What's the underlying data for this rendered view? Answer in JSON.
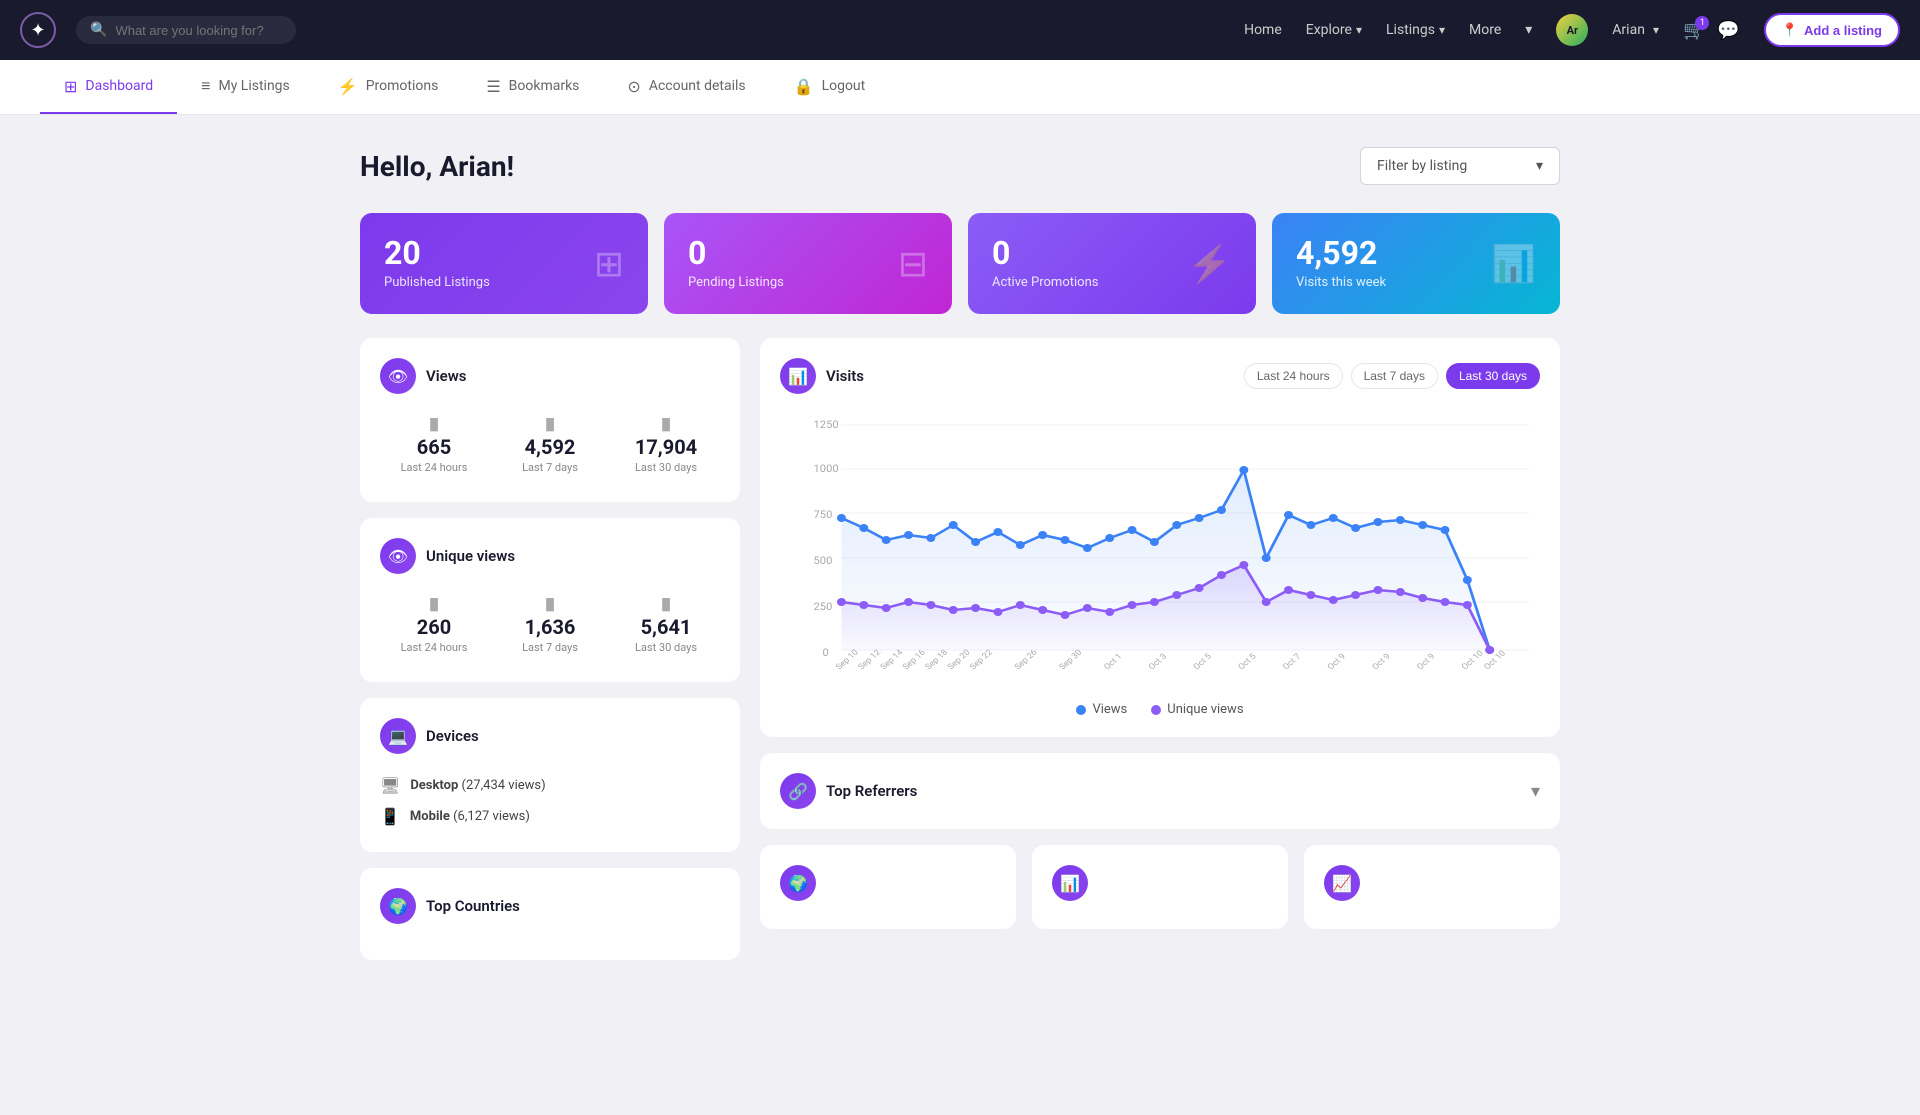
{
  "app": {
    "logo_char": "✦"
  },
  "top_nav": {
    "search_placeholder": "What are you looking for?",
    "links": [
      {
        "label": "Home",
        "has_dropdown": false
      },
      {
        "label": "Explore",
        "has_dropdown": true
      },
      {
        "label": "Listings",
        "has_dropdown": true
      },
      {
        "label": "More",
        "has_dropdown": true
      }
    ],
    "user": {
      "name": "Arian",
      "avatar_initials": "Ar"
    },
    "cart_count": "1",
    "add_listing_label": "Add a listing"
  },
  "sub_nav": {
    "items": [
      {
        "label": "Dashboard",
        "icon": "⊞",
        "active": true
      },
      {
        "label": "My Listings",
        "icon": "≡",
        "active": false
      },
      {
        "label": "Promotions",
        "icon": "⚡",
        "active": false
      },
      {
        "label": "Bookmarks",
        "icon": "☰",
        "active": false
      },
      {
        "label": "Account details",
        "icon": "⊙",
        "active": false
      },
      {
        "label": "Logout",
        "icon": "🔒",
        "active": false
      }
    ]
  },
  "page": {
    "title": "Hello, Arian!",
    "filter_label": "Filter by listing",
    "filter_placeholder": "Filter by listing"
  },
  "stat_cards": [
    {
      "number": "20",
      "label": "Published Listings",
      "icon": "⊞"
    },
    {
      "number": "0",
      "label": "Pending Listings",
      "icon": "⊟"
    },
    {
      "number": "0",
      "label": "Active Promotions",
      "icon": "⚡"
    },
    {
      "number": "4,592",
      "label": "Visits this week",
      "icon": "📊"
    }
  ],
  "views_widget": {
    "title": "Views",
    "stats": [
      {
        "value": "665",
        "label": "Last 24 hours"
      },
      {
        "value": "4,592",
        "label": "Last 7 days"
      },
      {
        "value": "17,904",
        "label": "Last 30 days"
      }
    ]
  },
  "unique_views_widget": {
    "title": "Unique views",
    "stats": [
      {
        "value": "260",
        "label": "Last 24 hours"
      },
      {
        "value": "1,636",
        "label": "Last 7 days"
      },
      {
        "value": "5,641",
        "label": "Last 30 days"
      }
    ]
  },
  "devices_widget": {
    "title": "Devices",
    "devices": [
      {
        "name": "Desktop",
        "views": "27,434 views"
      },
      {
        "name": "Mobile",
        "views": "6,127 views"
      }
    ]
  },
  "top_countries_widget": {
    "title": "Top Countries"
  },
  "visits_widget": {
    "title": "Visits",
    "time_filters": [
      {
        "label": "Last 24 hours",
        "active": false
      },
      {
        "label": "Last 7 days",
        "active": false
      },
      {
        "label": "Last 30 days",
        "active": true
      }
    ],
    "y_labels": [
      "1250",
      "1000",
      "750",
      "500",
      "250",
      "0"
    ],
    "legend": [
      {
        "label": "Views",
        "color": "#3b82f6"
      },
      {
        "label": "Unique views",
        "color": "#8b5cf6"
      }
    ]
  },
  "referrers_widget": {
    "title": "Top Referrers"
  },
  "colors": {
    "purple": "#7c3aed",
    "blue": "#3b82f6",
    "purple_light": "#8b5cf6"
  }
}
